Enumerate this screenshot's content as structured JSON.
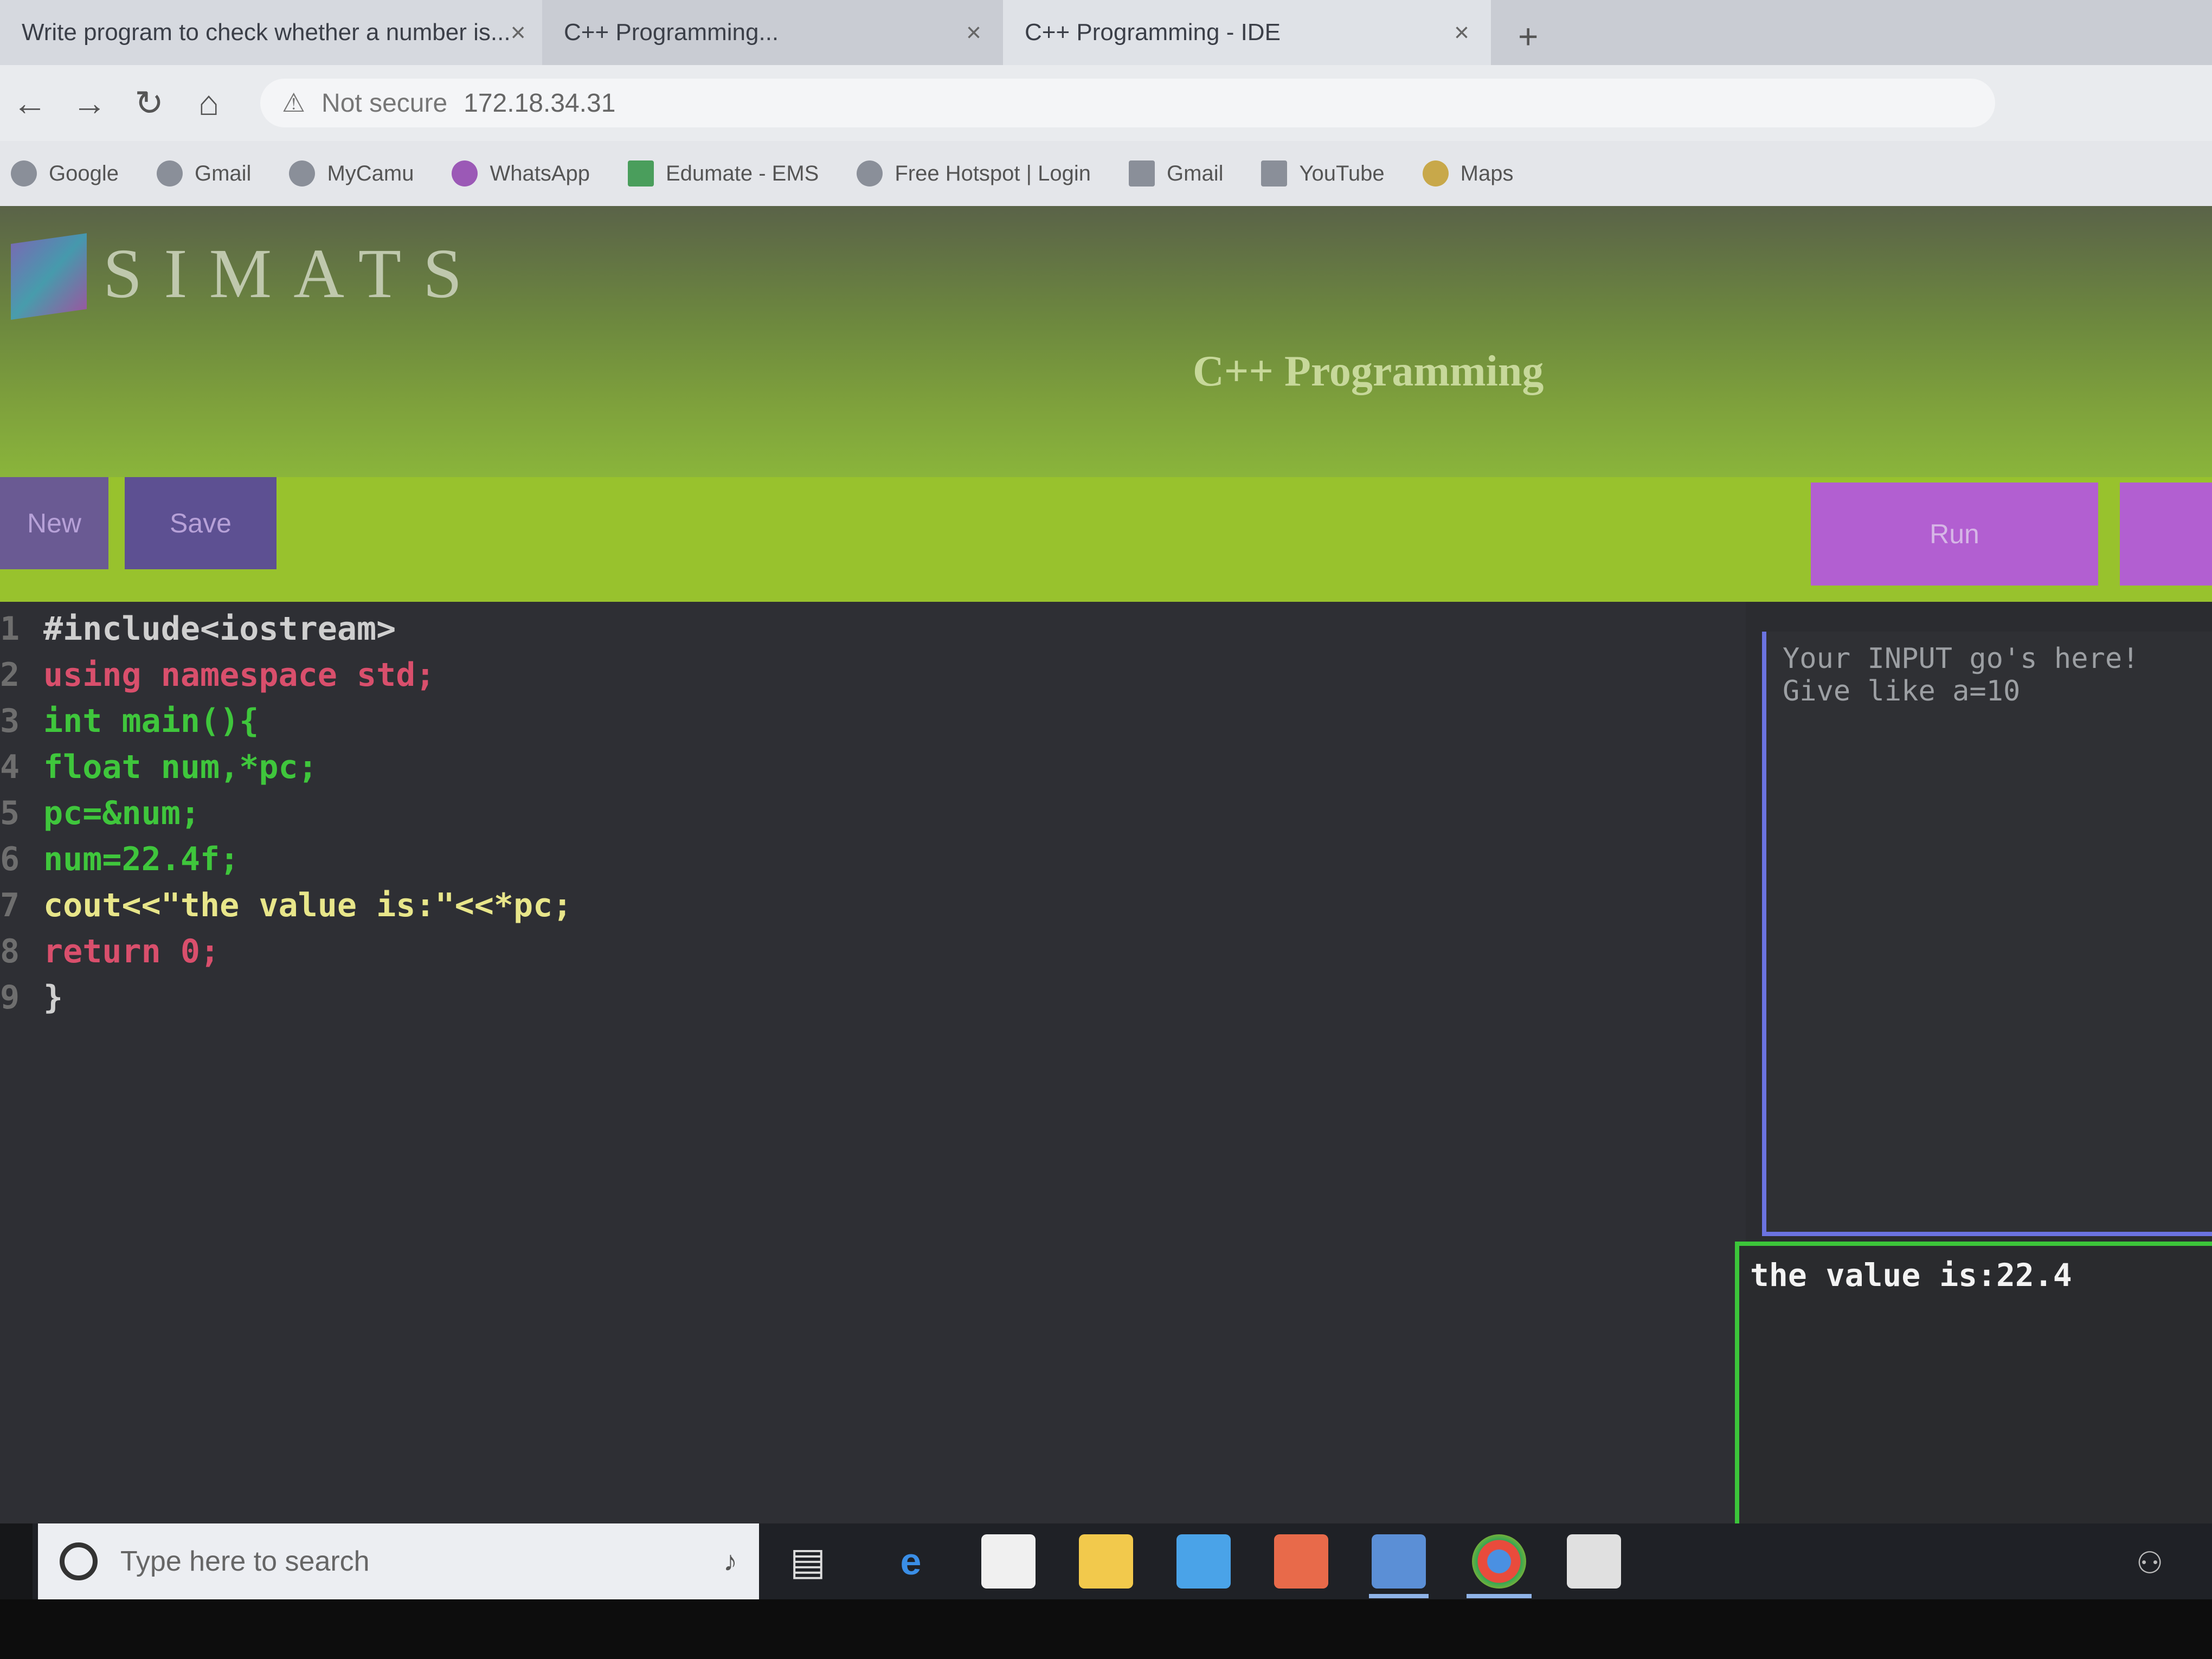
{
  "browser": {
    "tabs": [
      {
        "title": "Write program to check whether a number is..."
      },
      {
        "title": "C++ Programming..."
      },
      {
        "title": "C++ Programming - IDE"
      }
    ],
    "address": {
      "security_label": "Not secure",
      "url": "172.18.34.31"
    },
    "bookmarks": [
      "Google",
      "Gmail",
      "MyCamu",
      "WhatsApp",
      "Edumate - EMS",
      "Free Hotspot | Login",
      "Gmail",
      "YouTube",
      "Maps"
    ]
  },
  "site": {
    "brand": "SIMATS",
    "page_heading": "C++ Programming"
  },
  "ide": {
    "new_label": "New",
    "save_label": "Save",
    "run_label": "Run",
    "code_lines": [
      {
        "num": "1",
        "text": "#include<iostream>"
      },
      {
        "num": "2",
        "text": "using namespace std;"
      },
      {
        "num": "3",
        "text": "int main(){"
      },
      {
        "num": "4",
        "text": "float num,*pc;"
      },
      {
        "num": "5",
        "text": "pc=&num;"
      },
      {
        "num": "6",
        "text": "num=22.4f;"
      },
      {
        "num": "7",
        "text": "cout<<\"the value is:\"<<*pc;"
      },
      {
        "num": "8",
        "text": "return 0;"
      },
      {
        "num": "9",
        "text": "}"
      }
    ],
    "input_placeholder": "Your INPUT go's here! Give like a=10",
    "output_text": "the value is:22.4"
  },
  "taskbar": {
    "search_placeholder": "Type here to search",
    "icons": [
      "task-view-icon",
      "edge-icon",
      "store-icon",
      "file-explorer-icon",
      "mail-icon",
      "office-icon",
      "photos-icon",
      "chrome-icon",
      "app-icon"
    ]
  }
}
